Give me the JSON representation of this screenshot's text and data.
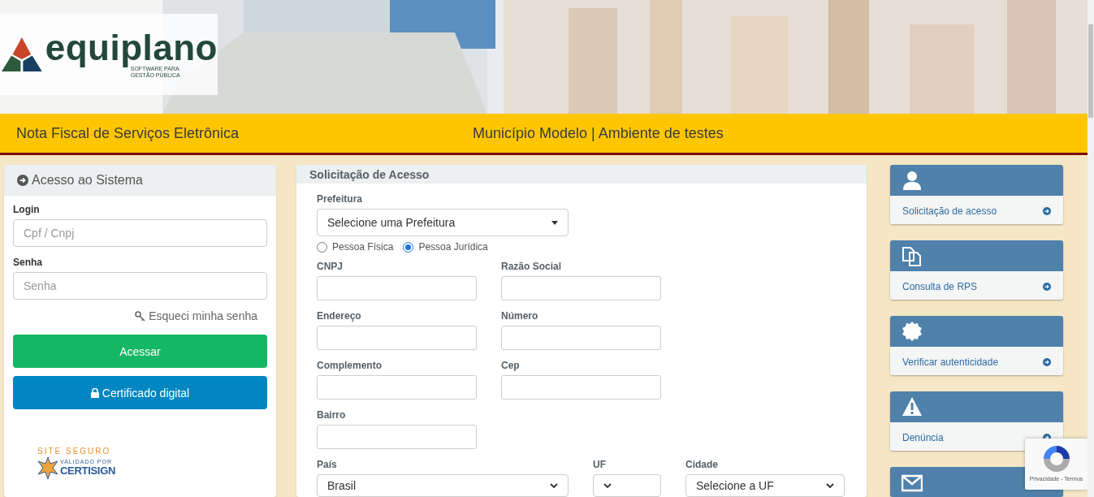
{
  "brand": {
    "name": "equiplano",
    "tagline_1": "SOFTWARE PARA",
    "tagline_2": "GESTÃO PÚBLICA"
  },
  "header": {
    "title": "Nota Fiscal de Serviços Eletrônica",
    "environment": "Município Modelo | Ambiente de testes"
  },
  "login_panel": {
    "title": "Acesso ao Sistema",
    "fields": [
      {
        "label": "Login",
        "placeholder": "Cpf / Cnpj"
      },
      {
        "label": "Senha",
        "placeholder": "Senha"
      }
    ],
    "forgot_link": "Esqueci minha senha",
    "submit_button": "Acessar",
    "certificate_button": "Certificado digital",
    "seal": {
      "title": "SITE SEGURO",
      "subtitle": "VALIDADO POR",
      "name": "CERTISIGN"
    }
  },
  "request_panel": {
    "title": "Solicitação de Acesso",
    "prefeitura": {
      "label": "Prefeitura",
      "value": "Selecione uma Prefeitura"
    },
    "person_types": [
      {
        "label": "Pessoa Física",
        "selected": false
      },
      {
        "label": "Pessoa Jurídica",
        "selected": true
      }
    ],
    "fields": [
      {
        "label": "CNPJ"
      },
      {
        "label": "Razão Social"
      },
      {
        "label": "Endereço"
      },
      {
        "label": "Número"
      },
      {
        "label": "Complemento"
      },
      {
        "label": "Cep"
      },
      {
        "label": "Bairro"
      }
    ],
    "selects": [
      {
        "label": "País",
        "value": "Brasil"
      },
      {
        "label": "UF"
      },
      {
        "label": "Cidade",
        "value": "Selecione a UF"
      }
    ]
  },
  "cards": [
    {
      "kind": "user",
      "label": "Solicitação de acesso"
    },
    {
      "kind": "copy",
      "label": "Consulta de RPS"
    },
    {
      "kind": "seal",
      "label": "Verificar autenticidade"
    },
    {
      "kind": "warning",
      "label": "Denúncia"
    },
    {
      "kind": "mail"
    }
  ],
  "recaptcha": {
    "links": "Privacidade - Termos"
  }
}
